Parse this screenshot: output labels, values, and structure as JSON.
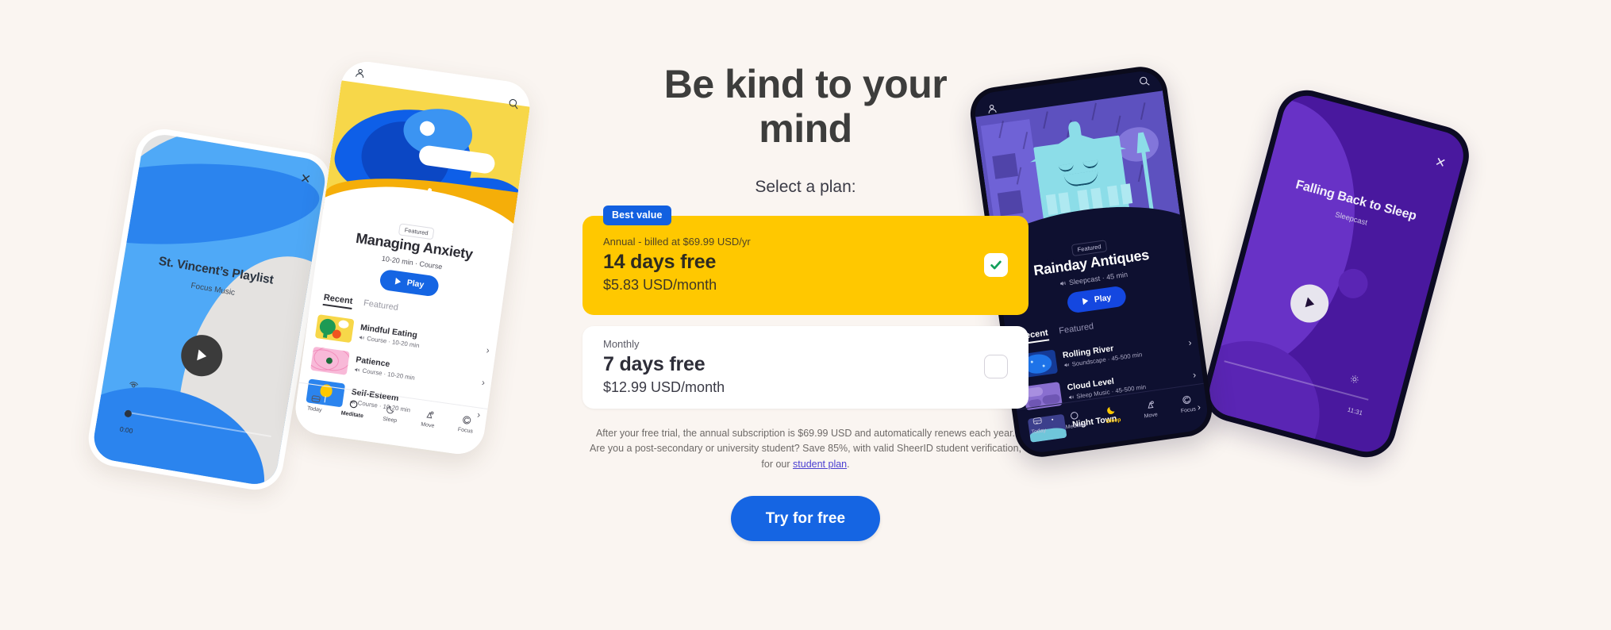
{
  "hero": {
    "headline": "Be kind to your mind",
    "select_plan_label": "Select a plan:"
  },
  "plans": {
    "best_value_badge": "Best value",
    "annual": {
      "kicker": "Annual - billed at $69.99 USD/yr",
      "title": "14 days free",
      "price": "$5.83 USD/month",
      "selected": true,
      "bg_color": "#FFC800"
    },
    "monthly": {
      "kicker": "Monthly",
      "title": "7 days free",
      "price": "$12.99 USD/month",
      "selected": false,
      "bg_color": "#FFFFFF"
    }
  },
  "fineprint": {
    "line1": "After your free trial, the annual subscription is $69.99 USD and automatically renews each year.",
    "line2": "Are you a post-secondary or university student? Save 85%, with valid SheerID student verification, for our",
    "link_text": "student plan",
    "trailing": "."
  },
  "cta": {
    "label": "Try for free",
    "color": "#1565E3"
  },
  "phone_playlist": {
    "title": "St. Vincent’s Playlist",
    "subtitle": "Focus Music",
    "time": "0:00"
  },
  "phone_anxiety": {
    "featured_badge": "Featured",
    "title": "Managing Anxiety",
    "meta": "10-20 min · Course",
    "play_label": "Play",
    "tabs": [
      {
        "label": "Recent",
        "active": true
      },
      {
        "label": "Featured",
        "active": false
      }
    ],
    "list": [
      {
        "title": "Mindful Eating",
        "meta": "Course · 10-20 min"
      },
      {
        "title": "Patience",
        "meta": "Course · 10-20 min"
      },
      {
        "title": "Self-Esteem",
        "meta": "Course · 10-20 min"
      }
    ],
    "nav": [
      {
        "label": "Today",
        "icon": "today-icon",
        "active": false
      },
      {
        "label": "Meditate",
        "icon": "meditate-icon",
        "active": true
      },
      {
        "label": "Sleep",
        "icon": "sleep-icon",
        "active": false
      },
      {
        "label": "Move",
        "icon": "move-icon",
        "active": false
      },
      {
        "label": "Focus",
        "icon": "focus-icon",
        "active": false
      }
    ]
  },
  "phone_sleepcast": {
    "featured_badge": "Featured",
    "title": "Rainday Antiques",
    "meta": "Sleepcast · 45 min",
    "play_label": "Play",
    "tabs": [
      {
        "label": "Recent",
        "active": true
      },
      {
        "label": "Featured",
        "active": false
      }
    ],
    "list": [
      {
        "title": "Rolling River",
        "meta": "Soundscape · 45-500 min"
      },
      {
        "title": "Cloud Level",
        "meta": "Sleep Music · 45-500 min"
      },
      {
        "title": "Night Town",
        "meta": ""
      }
    ],
    "nav": [
      {
        "label": "Today",
        "icon": "today-icon",
        "active": false
      },
      {
        "label": "Meditate",
        "icon": "meditate-icon",
        "active": false
      },
      {
        "label": "Sleep",
        "icon": "sleep-icon",
        "active": true
      },
      {
        "label": "Move",
        "icon": "move-icon",
        "active": false
      },
      {
        "label": "Focus",
        "icon": "focus-icon",
        "active": false
      }
    ]
  },
  "phone_falling": {
    "title": "Falling Back to Sleep",
    "subtitle": "Sleepcast",
    "time": "11:31"
  },
  "colors": {
    "background": "#FAF5F1",
    "accent_blue": "#1565E3",
    "accent_yellow": "#FFC800",
    "check_green": "#13A05C"
  }
}
